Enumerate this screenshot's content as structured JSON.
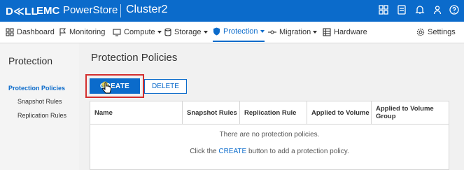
{
  "header": {
    "brand_dell": "D≪LL",
    "brand_emc": "EMC",
    "product": "PowerStore",
    "cluster": "Cluster2",
    "icons": [
      "grid-icon",
      "jobs-icon",
      "bell-icon",
      "user-icon",
      "help-icon"
    ]
  },
  "nav": {
    "items": [
      {
        "label": "Dashboard",
        "icon": "dashboard-icon"
      },
      {
        "label": "Monitoring",
        "icon": "flag-icon"
      },
      {
        "label": "Compute",
        "icon": "compute-icon"
      },
      {
        "label": "Storage",
        "icon": "storage-icon"
      },
      {
        "label": "Protection",
        "icon": "shield-icon",
        "active": true
      },
      {
        "label": "Migration",
        "icon": "migration-icon"
      },
      {
        "label": "Hardware",
        "icon": "hardware-icon"
      }
    ],
    "settings": "Settings"
  },
  "sidebar": {
    "title": "Protection",
    "items": [
      {
        "label": "Protection Policies",
        "active": true
      },
      {
        "label": "Snapshot Rules"
      },
      {
        "label": "Replication Rules"
      }
    ]
  },
  "main": {
    "title": "Protection Policies",
    "create_label": "CREATE",
    "delete_label": "DELETE",
    "table": {
      "columns": [
        "Name",
        "Snapshot Rules",
        "Replication Rule",
        "Applied to Volume",
        "Applied to Volume Group"
      ]
    },
    "empty_message": "There are no protection policies.",
    "hint_prefix": "Click the ",
    "hint_link": "CREATE",
    "hint_suffix": " button to add a protection policy."
  },
  "colors": {
    "brand_blue": "#0b6bcb",
    "highlight_red": "#d32f2f"
  }
}
